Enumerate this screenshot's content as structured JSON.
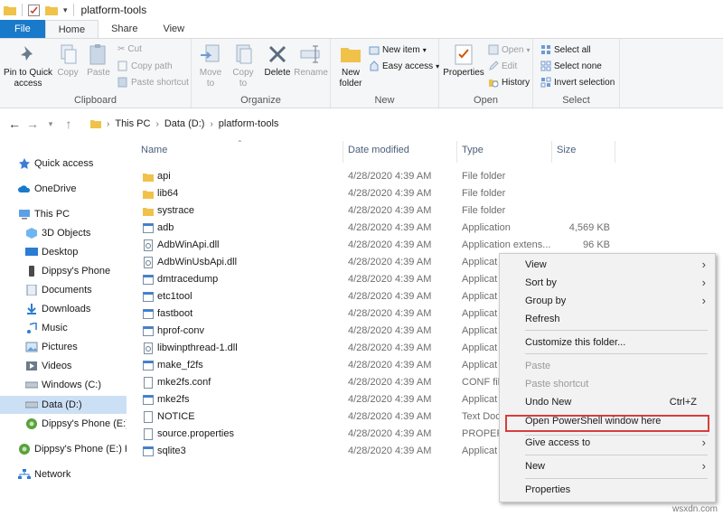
{
  "window": {
    "title": "platform-tools"
  },
  "ribbon_tabs": [
    "File",
    "Home",
    "Share",
    "View"
  ],
  "ribbon": {
    "clipboard": {
      "pin": "Pin to Quick access",
      "copy": "Copy",
      "paste": "Paste",
      "cut": "Cut",
      "copy_path": "Copy path",
      "paste_shortcut": "Paste shortcut",
      "label": "Clipboard"
    },
    "organize": {
      "move_to": "Move to",
      "copy_to": "Copy to",
      "delete": "Delete",
      "rename": "Rename",
      "label": "Organize"
    },
    "new": {
      "new_folder": "New folder",
      "new_item": "New item",
      "easy_access": "Easy access",
      "label": "New"
    },
    "open": {
      "properties": "Properties",
      "open": "Open",
      "edit": "Edit",
      "history": "History",
      "label": "Open"
    },
    "select": {
      "select_all": "Select all",
      "select_none": "Select none",
      "invert": "Invert selection",
      "label": "Select"
    }
  },
  "address": {
    "crumbs": [
      "This PC",
      "Data (D:)",
      "platform-tools"
    ]
  },
  "nav": [
    {
      "label": "Quick access",
      "icon": "star-icon"
    },
    {
      "label": "OneDrive",
      "icon": "cloud-icon"
    },
    {
      "label": "This PC",
      "icon": "pc-icon"
    },
    {
      "label": "3D Objects",
      "icon": "cube-icon"
    },
    {
      "label": "Desktop",
      "icon": "desktop-icon"
    },
    {
      "label": "Dippsy's Phone",
      "icon": "phone-icon"
    },
    {
      "label": "Documents",
      "icon": "document-icon"
    },
    {
      "label": "Downloads",
      "icon": "download-icon"
    },
    {
      "label": "Music",
      "icon": "music-icon"
    },
    {
      "label": "Pictures",
      "icon": "picture-icon"
    },
    {
      "label": "Videos",
      "icon": "video-icon"
    },
    {
      "label": "Windows (C:)",
      "icon": "drive-icon"
    },
    {
      "label": "Data (D:)",
      "icon": "drive-icon"
    },
    {
      "label": "Dippsy's Phone (E:)",
      "icon": "phone-drive-icon"
    },
    {
      "label": "Dippsy's Phone (E:) H",
      "icon": "phone-drive-icon"
    },
    {
      "label": "Network",
      "icon": "network-icon"
    }
  ],
  "columns": {
    "name": "Name",
    "date": "Date modified",
    "type": "Type",
    "size": "Size"
  },
  "files": [
    {
      "name": "api",
      "date": "4/28/2020 4:39 AM",
      "type": "File folder",
      "size": "",
      "kind": "folder"
    },
    {
      "name": "lib64",
      "date": "4/28/2020 4:39 AM",
      "type": "File folder",
      "size": "",
      "kind": "folder"
    },
    {
      "name": "systrace",
      "date": "4/28/2020 4:39 AM",
      "type": "File folder",
      "size": "",
      "kind": "folder"
    },
    {
      "name": "adb",
      "date": "4/28/2020 4:39 AM",
      "type": "Application",
      "size": "4,569 KB",
      "kind": "app"
    },
    {
      "name": "AdbWinApi.dll",
      "date": "4/28/2020 4:39 AM",
      "type": "Application extens...",
      "size": "96 KB",
      "kind": "dll"
    },
    {
      "name": "AdbWinUsbApi.dll",
      "date": "4/28/2020 4:39 AM",
      "type": "Applicat",
      "size": "",
      "kind": "dll"
    },
    {
      "name": "dmtracedump",
      "date": "4/28/2020 4:39 AM",
      "type": "Applicat",
      "size": "",
      "kind": "app"
    },
    {
      "name": "etc1tool",
      "date": "4/28/2020 4:39 AM",
      "type": "Applicat",
      "size": "",
      "kind": "app"
    },
    {
      "name": "fastboot",
      "date": "4/28/2020 4:39 AM",
      "type": "Applicat",
      "size": "",
      "kind": "app"
    },
    {
      "name": "hprof-conv",
      "date": "4/28/2020 4:39 AM",
      "type": "Applicat",
      "size": "",
      "kind": "app"
    },
    {
      "name": "libwinpthread-1.dll",
      "date": "4/28/2020 4:39 AM",
      "type": "Applicat",
      "size": "",
      "kind": "dll"
    },
    {
      "name": "make_f2fs",
      "date": "4/28/2020 4:39 AM",
      "type": "Applicat",
      "size": "",
      "kind": "app"
    },
    {
      "name": "mke2fs.conf",
      "date": "4/28/2020 4:39 AM",
      "type": "CONF file",
      "size": "",
      "kind": "file"
    },
    {
      "name": "mke2fs",
      "date": "4/28/2020 4:39 AM",
      "type": "Applicat",
      "size": "",
      "kind": "app"
    },
    {
      "name": "NOTICE",
      "date": "4/28/2020 4:39 AM",
      "type": "Text Doc",
      "size": "",
      "kind": "file"
    },
    {
      "name": "source.properties",
      "date": "4/28/2020 4:39 AM",
      "type": "PROPERT",
      "size": "",
      "kind": "file"
    },
    {
      "name": "sqlite3",
      "date": "4/28/2020 4:39 AM",
      "type": "Applicat",
      "size": "",
      "kind": "app"
    }
  ],
  "context_menu": {
    "view": "View",
    "sort_by": "Sort by",
    "group_by": "Group by",
    "refresh": "Refresh",
    "customize": "Customize this folder...",
    "paste": "Paste",
    "paste_shortcut": "Paste shortcut",
    "undo_new": "Undo New",
    "undo_shortcut": "Ctrl+Z",
    "open_powershell": "Open PowerShell window here",
    "give_access": "Give access to",
    "new": "New",
    "properties": "Properties"
  },
  "watermark": "wsxdn.com",
  "colors": {
    "accent": "#1979ca",
    "highlight_box": "#d93d3d",
    "selected": "#cce0f5"
  }
}
